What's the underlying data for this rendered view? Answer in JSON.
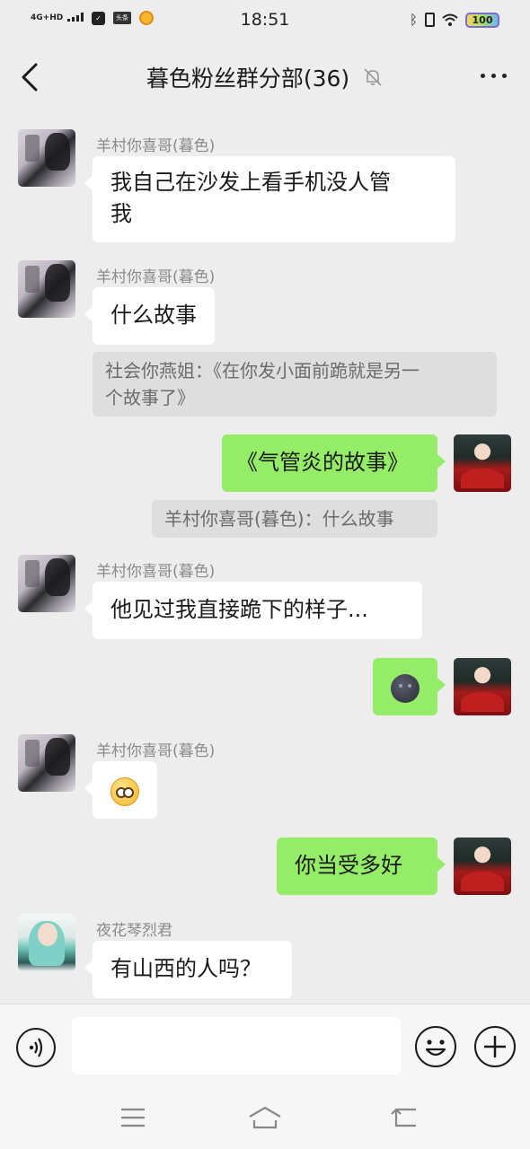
{
  "status_bar": {
    "network": "4G+HD",
    "time": "18:51",
    "battery": "100",
    "notification_icons": [
      "check-icon",
      "toutiao-icon",
      "app-icon"
    ]
  },
  "header": {
    "title": "暮色粉丝群分部(36)",
    "muted": true
  },
  "messages": [
    {
      "side": "left",
      "sender": "羊村你喜哥(暮色)",
      "avatar": "user-avatar-yangcun",
      "text_lines": [
        "我自己在沙发上看手机没人管",
        "我"
      ]
    },
    {
      "side": "left",
      "sender": "羊村你喜哥(暮色)",
      "avatar": "user-avatar-yangcun",
      "text": "什么故事",
      "quote_lines": [
        "社会你燕姐：《在你发小面前跪就是另一",
        "个故事了》"
      ]
    },
    {
      "side": "right",
      "avatar": "self-avatar",
      "text": "《气管炎的故事》",
      "quote": "羊村你喜哥(暮色)：什么故事"
    },
    {
      "side": "left",
      "sender": "羊村你喜哥(暮色)",
      "avatar": "user-avatar-yangcun",
      "text": "他见过我直接跪下的样子..."
    },
    {
      "side": "right",
      "avatar": "self-avatar",
      "emoji": "new-moon-face-emoji"
    },
    {
      "side": "left",
      "sender": "羊村你喜哥(暮色)",
      "avatar": "user-avatar-yangcun",
      "emoji": "pleading-face-emoji"
    },
    {
      "side": "right",
      "avatar": "self-avatar",
      "text": "你当受多好"
    },
    {
      "side": "left",
      "sender": "夜花琴烈君",
      "avatar": "user-avatar-yehua",
      "text": "有山西的人吗？"
    }
  ],
  "input_bar": {
    "value": "",
    "placeholder": ""
  },
  "colors": {
    "background": "#ededed",
    "self_bubble": "#95ec69",
    "other_bubble": "#ffffff",
    "quote_bg": "#dedede"
  }
}
